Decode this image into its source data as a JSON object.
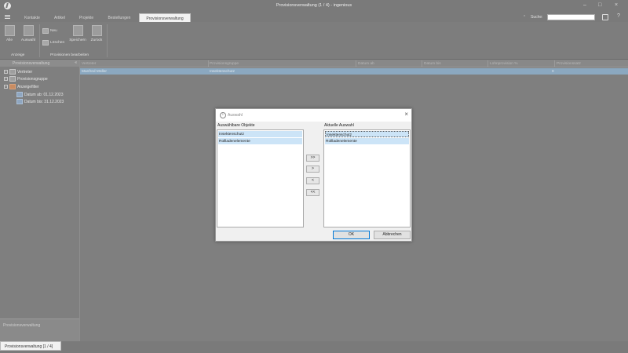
{
  "window": {
    "title": "Provisionsverwaltung (1 / 4) - ingenious"
  },
  "menu": {
    "tabs": [
      {
        "label": "Kontakte"
      },
      {
        "label": "Artikel"
      },
      {
        "label": "Projekte"
      },
      {
        "label": "Bestellungen"
      },
      {
        "label": "Provisionsverwaltung"
      }
    ],
    "search_label": "Suche:",
    "search_value": ""
  },
  "ribbon": {
    "all_label": "Alle",
    "selection_label": "Auswahl",
    "group_view_label": "Anzeige",
    "new_label": "Neu",
    "delete_label": "Löschen",
    "save_label": "Speichern",
    "back_label": "Zurück",
    "group_edit_label": "Provisionen bearbeiten"
  },
  "sidebar": {
    "header": "Provisionsverwaltung",
    "items": [
      {
        "label": "Vertreter"
      },
      {
        "label": "Provisionsgruppe"
      },
      {
        "label": "Anzeigefilter"
      }
    ],
    "filters": [
      {
        "label": "Datum ab: 01.12.2023"
      },
      {
        "label": "Datum bis: 31.12.2023"
      }
    ],
    "bottom_title": "Provisionsverwaltung"
  },
  "grid": {
    "columns": [
      "Vertreter",
      "Provisionsgruppe",
      "Datum ab",
      "Datum bis",
      "Lohnprovision %",
      "Provisionssatz"
    ],
    "rows": [
      {
        "cells": [
          "Manfred Müller",
          "Insektenschutz",
          "",
          "",
          "",
          "0"
        ]
      }
    ]
  },
  "dialog": {
    "title": "Auswahl",
    "available_label": "Auswählbare Objekte",
    "current_label": "Aktuelle Auswahl",
    "available_items": [
      "Insektenschutz",
      "Rollladenelemente"
    ],
    "current_items": [
      "Insektenschutz",
      "Rollladenelemente"
    ],
    "move_all_right": ">>",
    "move_right": ">",
    "move_left": "<",
    "move_all_left": "<<",
    "ok_label": "OK",
    "cancel_label": "Abbrechen"
  },
  "status": {
    "tab_label": "Provisionsverwaltung [1 / 4]"
  }
}
